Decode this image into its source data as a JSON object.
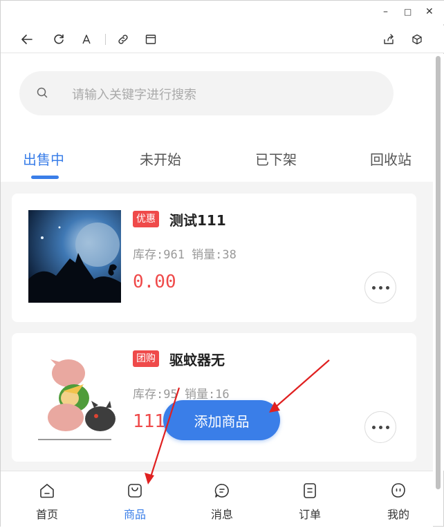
{
  "window": {
    "minimize": "–",
    "maximize": "□",
    "close": "✕"
  },
  "search": {
    "placeholder": "请输入关键字进行搜索"
  },
  "tabs": [
    {
      "label": "出售中",
      "active": true
    },
    {
      "label": "未开始"
    },
    {
      "label": "已下架"
    },
    {
      "label": "回收站"
    }
  ],
  "products": [
    {
      "badge": "优惠",
      "name": "测试111",
      "stock_sales": "库存:961 销量:38",
      "price": "0.00",
      "image": "wolf-moon-image"
    },
    {
      "badge": "团购",
      "name": "驱蚊器无",
      "stock_sales": "库存:95 销量:16",
      "price": "111",
      "image": "cartoon-character-image"
    }
  ],
  "fab": {
    "label": "添加商品"
  },
  "nav": [
    {
      "label": "首页",
      "icon": "home-icon"
    },
    {
      "label": "商品",
      "icon": "bag-icon",
      "active": true
    },
    {
      "label": "消息",
      "icon": "message-icon"
    },
    {
      "label": "订单",
      "icon": "order-icon"
    },
    {
      "label": "我的",
      "icon": "profile-icon"
    }
  ],
  "colors": {
    "accent": "#3a7ee8",
    "price": "#ef4a4a",
    "badge": "#ef4a4a",
    "annotation": "#e02020"
  }
}
